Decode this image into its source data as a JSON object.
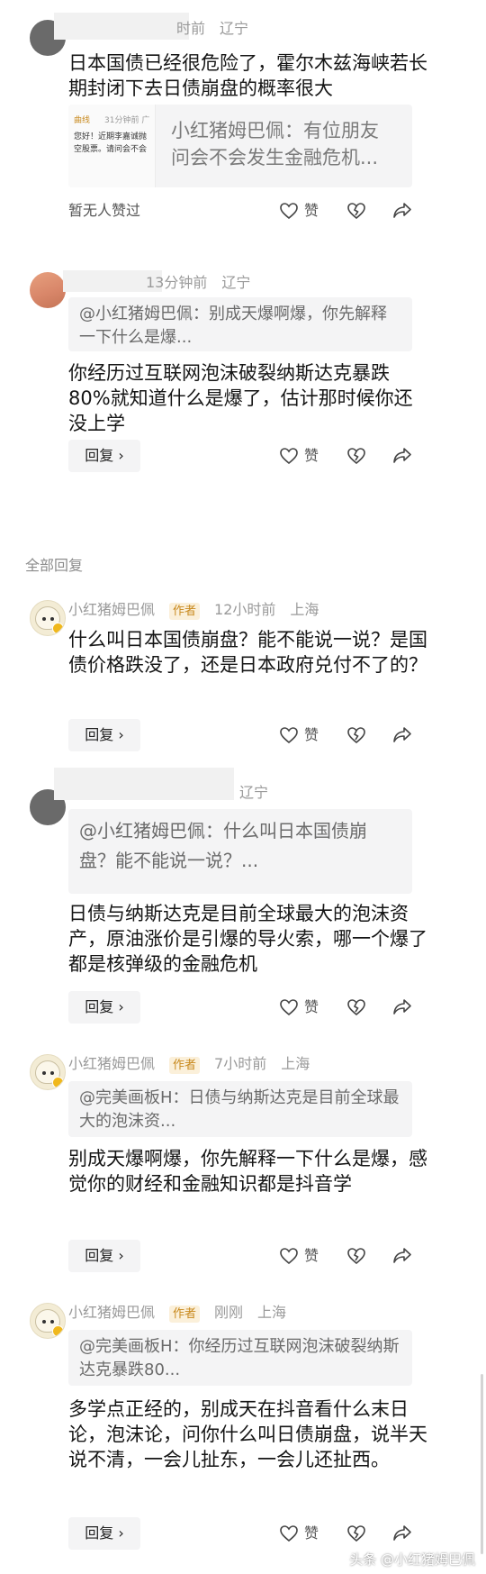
{
  "comments": [
    {
      "meta_time": "时前",
      "meta_location": "辽宁",
      "text": "日本国债已经很危险了，霍尔木兹海峡若长期封闭下去日债崩盘的概率很大",
      "preview": {
        "thumb_author": "曲线",
        "thumb_time": "31分钟前 广",
        "thumb_line1": "您好！近期李嘉诚抛",
        "thumb_line2": "空股票。请问会不会",
        "text": "小红猪姆巴佩：有位朋友问会不会发生金融危机..."
      },
      "likes_label": "暂无人赞过",
      "like_label": "赞"
    },
    {
      "meta_time": "13分钟前",
      "meta_location": "辽宁",
      "quote": "@小红猪姆巴佩：别成天爆啊爆，你先解释一下什么是爆...",
      "text": "你经历过互联网泡沫破裂纳斯达克暴跌80%就知道什么是爆了，估计那时候你还没上学",
      "reply_label": "回复",
      "like_label": "赞"
    }
  ],
  "section_title": "全部回复",
  "replies": [
    {
      "name": "小红猪姆巴佩",
      "tag": "作者",
      "time": "12小时前",
      "location": "上海",
      "text": "什么叫日本国债崩盘？能不能说一说？是国债价格跌没了，还是日本政府兑付不了的？",
      "reply_label": "回复",
      "like_label": "赞"
    },
    {
      "location": "辽宁",
      "quote": "@小红猪姆巴佩：什么叫日本国债崩盘？能不能说一说？...",
      "text": "日债与纳斯达克是目前全球最大的泡沫资产，原油涨价是引爆的导火索，哪一个爆了都是核弹级的金融危机",
      "reply_label": "回复",
      "like_label": "赞"
    },
    {
      "name": "小红猪姆巴佩",
      "tag": "作者",
      "time": "7小时前",
      "location": "上海",
      "quote": "@完美画板H：日债与纳斯达克是目前全球最大的泡沫资...",
      "text": "别成天爆啊爆，你先解释一下什么是爆，感觉你的财经和金融知识都是抖音学",
      "reply_label": "回复",
      "like_label": "赞"
    },
    {
      "name": "小红猪姆巴佩",
      "tag": "作者",
      "time": "刚刚",
      "location": "上海",
      "quote": "@完美画板H：你经历过互联网泡沫破裂纳斯达克暴跌80...",
      "text": "多学点正经的，别成天在抖音看什么末日论，泡沫论，问你什么叫日债崩盘，说半天说不清，一会儿扯东，一会儿还扯西。",
      "reply_label": "回复",
      "like_label": "赞"
    }
  ],
  "watermark": "头条 @小红猪姆巴佩",
  "colors": {
    "author_tag": "#c8891d",
    "author_tag_bg": "#fbf0da",
    "quote_bg": "#f4f4f5",
    "meta": "#9a9a9a"
  }
}
